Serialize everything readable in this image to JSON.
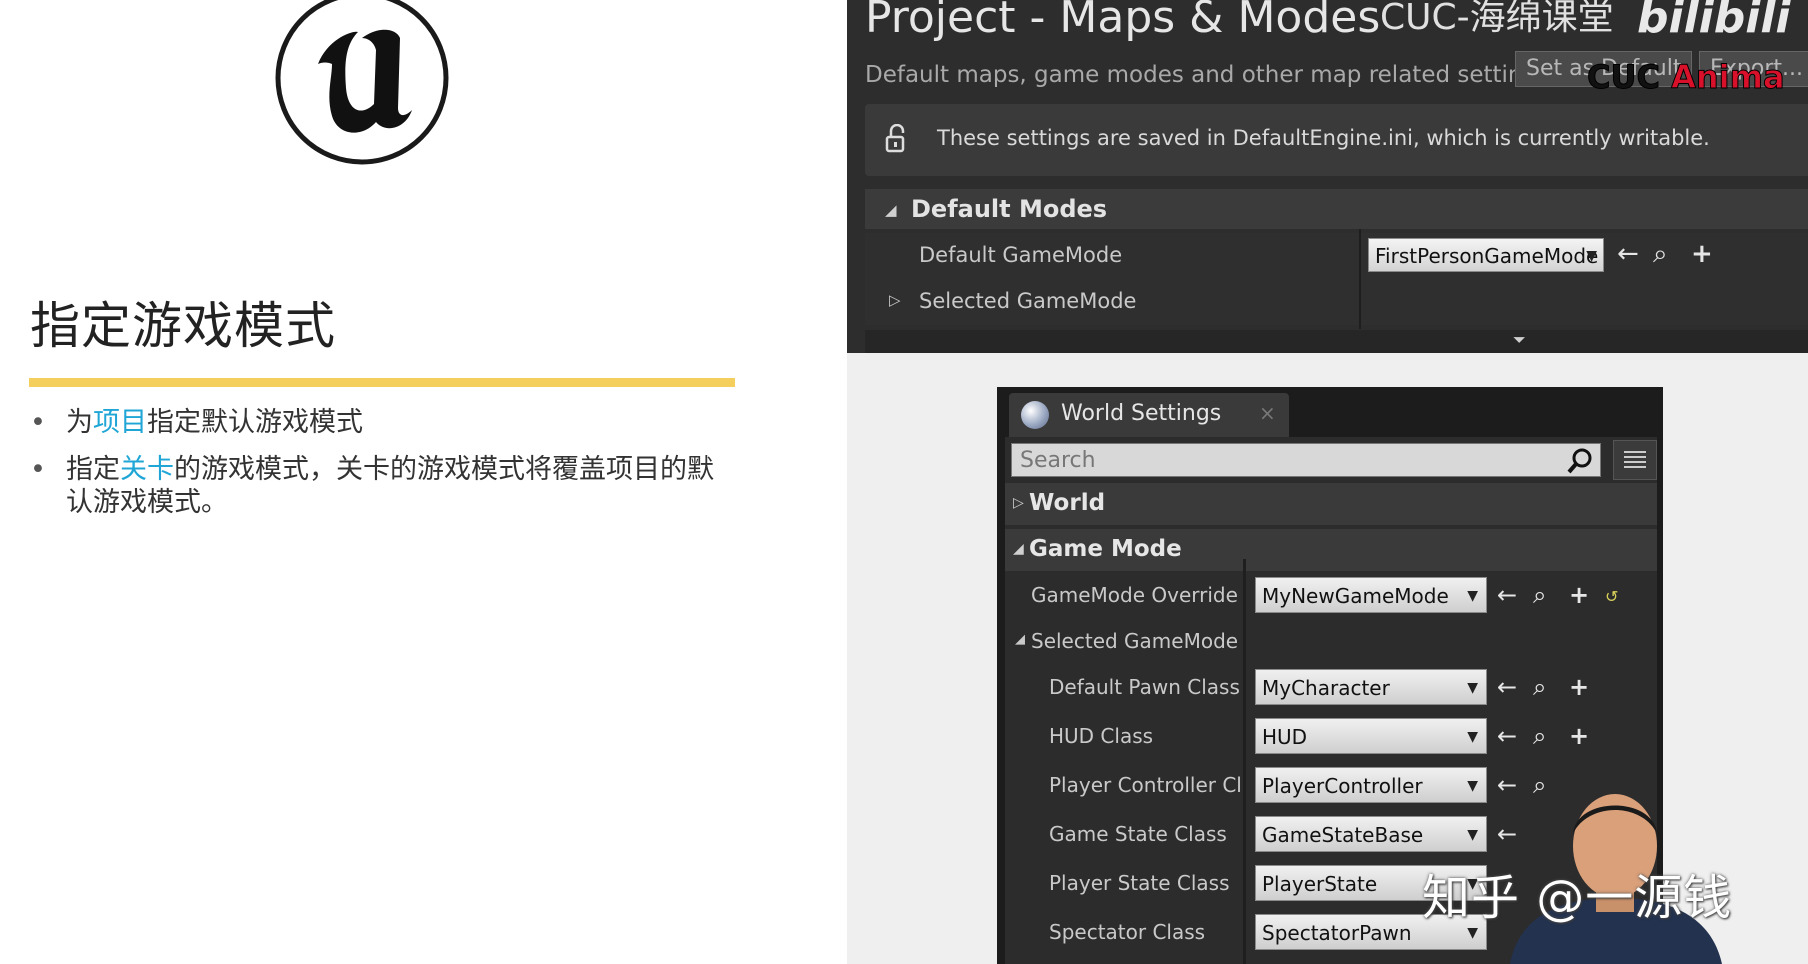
{
  "slide": {
    "logo_name": "Unreal Engine",
    "title": "指定游戏模式",
    "bullets": [
      {
        "pre": "为",
        "hl": "项目",
        "post": "指定默认游戏模式"
      },
      {
        "pre": "指定",
        "hl": "关卡",
        "post": "的游戏模式，关卡的游戏模式将覆盖项目的默认游戏模式。"
      }
    ]
  },
  "project_settings": {
    "title": "Project - Maps & Modes",
    "subtitle": "Default maps, game modes and other map related settings.",
    "buttons": {
      "set_default": "Set as Default",
      "export": "Export..."
    },
    "info": "These settings are saved in DefaultEngine.ini, which is currently writable.",
    "section": "Default Modes",
    "rows": [
      {
        "label": "Default GameMode",
        "value": "FirstPersonGameMode"
      },
      {
        "label": "Selected GameMode"
      }
    ]
  },
  "watermarks": {
    "cuc": "CUC-海绵课堂",
    "bili": "bilibili",
    "anima_a": "CUC",
    "anima_b": "Anima",
    "zhihu": "知乎 @一源钱"
  },
  "world_settings": {
    "tab_title": "World Settings",
    "tab_close": "×",
    "search_placeholder": "Search",
    "categories": {
      "world": "World",
      "game_mode": "Game Mode"
    },
    "override": {
      "label": "GameMode Override",
      "value": "MyNewGameMode"
    },
    "selected_label": "Selected GameMode",
    "classes": [
      {
        "label": "Default Pawn Class",
        "value": "MyCharacter"
      },
      {
        "label": "HUD Class",
        "value": "HUD"
      },
      {
        "label": "Player Controller Cla",
        "value": "PlayerController"
      },
      {
        "label": "Game State Class",
        "value": "GameStateBase"
      },
      {
        "label": "Player State Class",
        "value": "PlayerState"
      },
      {
        "label": "Spectator Class",
        "value": "SpectatorPawn"
      }
    ]
  },
  "icons": {
    "arrow_left": "←",
    "browse": "⌕",
    "add": "+",
    "dropdown": "▼",
    "reset": "↺"
  }
}
